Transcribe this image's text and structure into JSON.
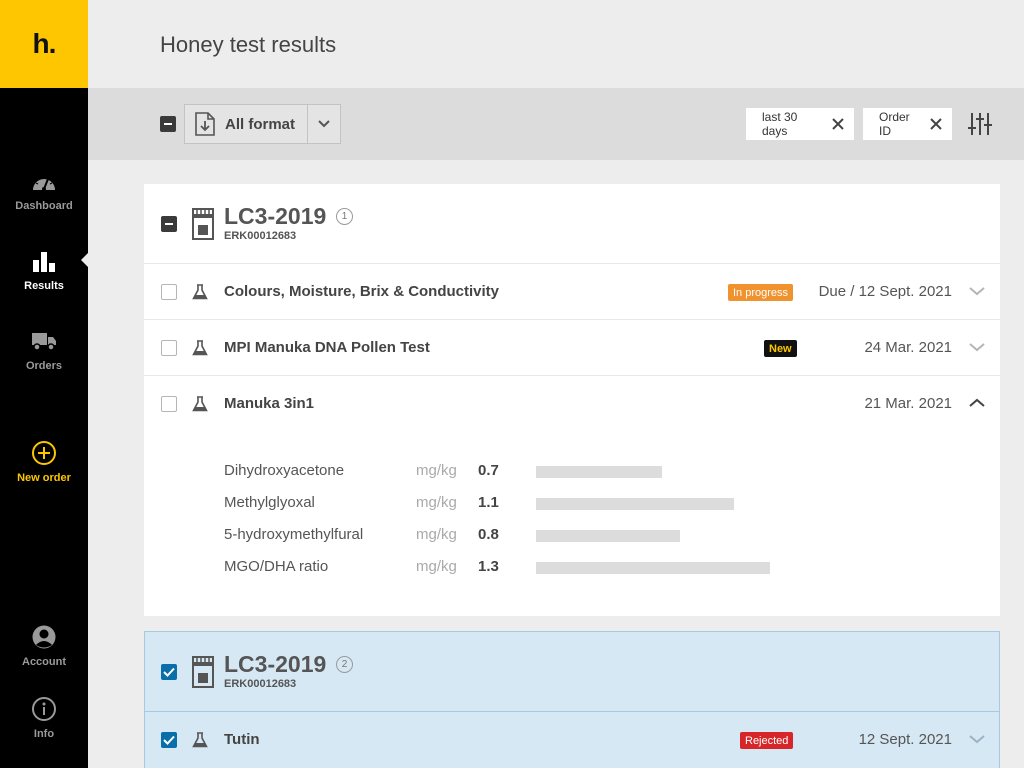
{
  "brand": {
    "logo_text": "h.",
    "accent": "#fdc600"
  },
  "sidebar": {
    "items": [
      {
        "label": "Dashboard",
        "icon": "gauge-icon"
      },
      {
        "label": "Results",
        "icon": "bar-chart-icon",
        "active": true
      },
      {
        "label": "Orders",
        "icon": "truck-icon"
      },
      {
        "label": "New order",
        "icon": "plus-circle-icon"
      },
      {
        "label": "Account",
        "icon": "user-circle-icon"
      },
      {
        "label": "Info",
        "icon": "info-circle-icon"
      }
    ]
  },
  "header": {
    "title": "Honey test results"
  },
  "toolbar": {
    "format_label": "All format",
    "chips": [
      {
        "label": "last 30 days"
      },
      {
        "label": "Order ID"
      }
    ]
  },
  "cards": [
    {
      "title": "LC3-2019",
      "count": "1",
      "sub": "ERK00012683",
      "rows": [
        {
          "name": "Colours, Moisture, Brix & Conductivity",
          "badge": "In progress",
          "date": "Due / 12 Sept. 2021"
        },
        {
          "name": "MPI Manuka DNA Pollen Test",
          "badge": "New",
          "date": "24 Mar. 2021"
        },
        {
          "name": "Manuka 3in1",
          "badge": "",
          "date": "21 Mar. 2021",
          "expanded": true
        }
      ],
      "metrics": [
        {
          "name": "Dihydroxyacetone",
          "unit": "mg/kg",
          "value": "0.7"
        },
        {
          "name": "Methylglyoxal",
          "unit": "mg/kg",
          "value": "1.1"
        },
        {
          "name": "5-hydroxymethylfural",
          "unit": "mg/kg",
          "value": "0.8"
        },
        {
          "name": "MGO/DHA ratio",
          "unit": "mg/kg",
          "value": "1.3"
        }
      ]
    },
    {
      "title": "LC3-2019",
      "count": "2",
      "sub": "ERK00012683",
      "selected": true,
      "rows": [
        {
          "name": "Tutin",
          "badge": "Rejected",
          "date": "12 Sept. 2021"
        }
      ]
    }
  ],
  "colors": {
    "in_progress": "#f0922e",
    "new_badge_bg": "#111111",
    "new_badge_fg": "#fdc600",
    "rejected": "#d7262a",
    "selected_bg": "#d6e8f4",
    "checkbox_checked": "#0a6eaa"
  }
}
